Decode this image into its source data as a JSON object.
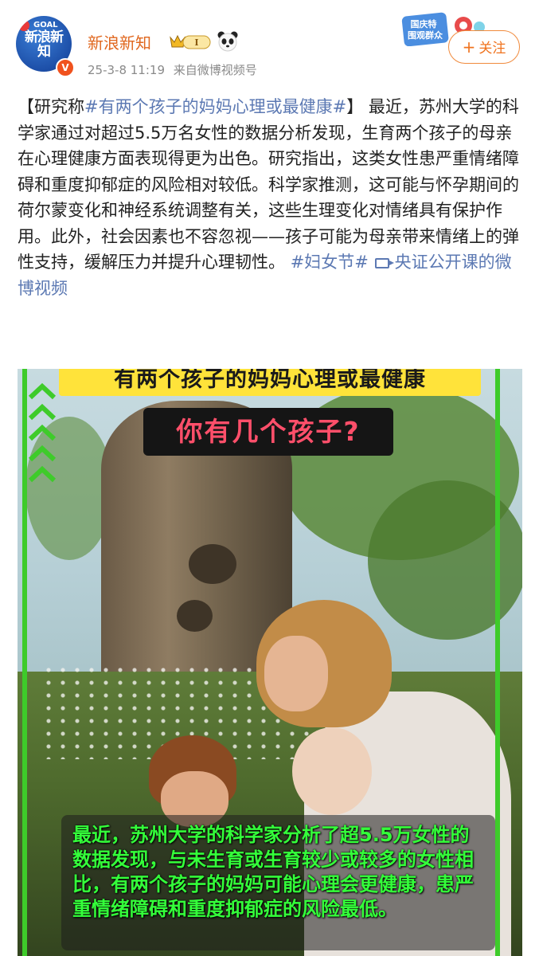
{
  "post": {
    "author": {
      "name": "新浪新知",
      "avatar_text": "新浪新知",
      "avatar_logo": "GOAL",
      "verified_badge": "V",
      "level_badge": "I"
    },
    "timestamp": "25-3-8 11:19",
    "source": "来自微博视频号",
    "follow_button": "+关注",
    "follow_plus": "+",
    "follow_label": "关注",
    "sticker_text": [
      "国庆特",
      "围观群众"
    ],
    "content": {
      "bracket_open": "【研究称",
      "topic1": "#有两个孩子的妈妈心理或最健康#",
      "bracket_close": "】",
      "body": "最近，苏州大学的科学家通过对超过5.5万名女性的数据分析发现，生育两个孩子的母亲在心理健康方面表现得更为出色。研究指出，这类女性患严重情绪障碍和重度抑郁症的风险相对较低。科学家推测，这可能与怀孕期间的荷尔蒙变化和神经系统调整有关，这些生理变化对情绪具有保护作用。此外，社会因素也不容忽视——孩子可能为母亲带来情绪上的弹性支持，缓解压力并提升心理韧性。",
      "topic2": "#妇女节#",
      "video_link": "央证公开课的微博视频"
    },
    "video": {
      "banner_title": "有两个孩子的妈妈心理或最健康",
      "question": "你有几个孩子?",
      "subtitle": "最近，苏州大学的科学家分析了超5.5万女性的数据发现，与未生育或生育较少或较多的女性相比，有两个孩子的妈妈可能心理会更健康，患严重情绪障碍和重度抑郁症的风险最低。"
    }
  },
  "colors": {
    "username": "#e0671e",
    "link": "#5c79b3",
    "follow": "#f0731e",
    "banner": "#ffe33a",
    "question_text": "#ff4f6a",
    "subtitle_text": "#34ff3a",
    "side_bar": "#3ecb2a"
  },
  "icons": [
    "crown-badge-icon",
    "panda-icon",
    "video-link-icon",
    "chevron-up-icon"
  ]
}
